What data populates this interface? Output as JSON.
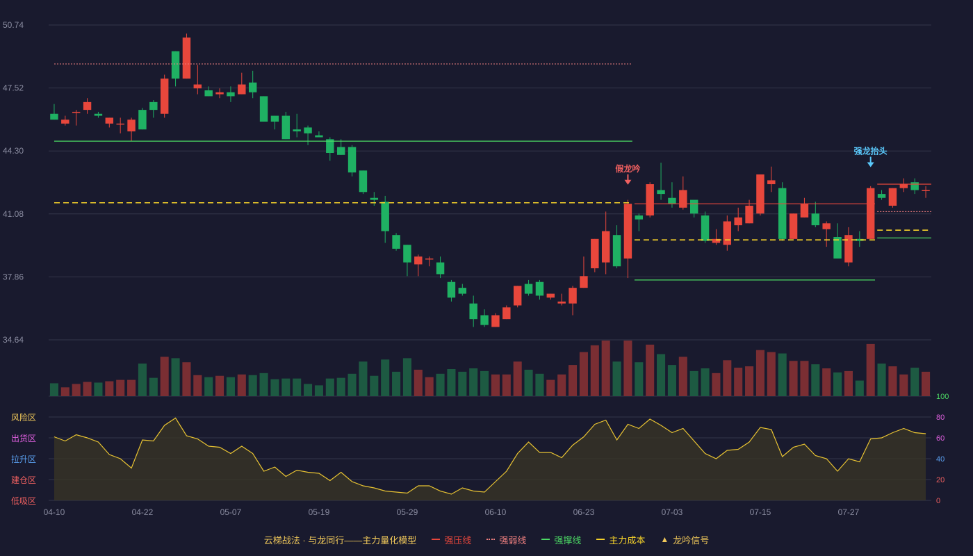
{
  "colors": {
    "up": "#e8473c",
    "down": "#1fb163",
    "up_vol": "#7a2e33",
    "down_vol": "#1d5a42",
    "grid": "#34364a",
    "axis_text": "#8a8ca0",
    "pressure": "#e8473c",
    "weak": "#f08080",
    "support": "#4cd964",
    "cost": "#f5d12a",
    "osc_line": "#e8c332"
  },
  "legend": {
    "title": "云梯战法 · 与龙同行——主力量化模型",
    "items": [
      {
        "label": "强压线",
        "color": "#e8473c",
        "style": "solid"
      },
      {
        "label": "强弱线",
        "color": "#f08080",
        "style": "dotted"
      },
      {
        "label": "强撑线",
        "color": "#4cd964",
        "style": "solid"
      },
      {
        "label": "主力成本",
        "color": "#f5d12a",
        "style": "dashed"
      },
      {
        "label": "龙吟信号",
        "color": "#f0c85a",
        "style": "triangle"
      }
    ]
  },
  "chart_data": {
    "type": "candlestick",
    "price_axis": {
      "ticks": [
        "50.74",
        "47.52",
        "44.30",
        "41.08",
        "37.86",
        "34.64"
      ],
      "ylim": [
        34.64,
        50.74
      ]
    },
    "x_ticks": [
      {
        "index": 0,
        "label": "04-10"
      },
      {
        "index": 8,
        "label": "04-22"
      },
      {
        "index": 16,
        "label": "05-07"
      },
      {
        "index": 24,
        "label": "05-19"
      },
      {
        "index": 32,
        "label": "05-29"
      },
      {
        "index": 40,
        "label": "06-10"
      },
      {
        "index": 48,
        "label": "06-23"
      },
      {
        "index": 56,
        "label": "07-03"
      },
      {
        "index": 64,
        "label": "07-15"
      },
      {
        "index": 72,
        "label": "07-27"
      }
    ],
    "candles": [
      [
        46.2,
        45.9,
        46.7,
        45.9
      ],
      [
        45.7,
        45.9,
        46.1,
        45.6
      ],
      [
        46.3,
        46.3,
        46.4,
        45.6
      ],
      [
        46.4,
        46.8,
        47.0,
        46.2
      ],
      [
        46.2,
        46.1,
        46.3,
        46.0
      ],
      [
        45.7,
        46.0,
        46.0,
        45.5
      ],
      [
        45.7,
        45.7,
        46.0,
        45.2
      ],
      [
        45.3,
        45.9,
        46.0,
        44.8
      ],
      [
        46.4,
        45.4,
        46.5,
        45.4
      ],
      [
        46.8,
        46.4,
        46.9,
        46.0
      ],
      [
        46.2,
        48.0,
        48.2,
        46.0
      ],
      [
        49.4,
        48.0,
        49.4,
        47.6
      ],
      [
        48.0,
        50.1,
        50.3,
        48.0
      ],
      [
        47.5,
        47.7,
        48.7,
        47.2
      ],
      [
        47.4,
        47.1,
        47.6,
        47.1
      ],
      [
        47.2,
        47.3,
        47.5,
        47.0
      ],
      [
        47.3,
        47.1,
        47.6,
        46.8
      ],
      [
        47.2,
        47.7,
        48.3,
        47.2
      ],
      [
        47.8,
        47.3,
        48.4,
        47.0
      ],
      [
        47.1,
        45.8,
        47.1,
        45.8
      ],
      [
        46.1,
        45.8,
        46.1,
        45.4
      ],
      [
        46.1,
        44.9,
        46.3,
        44.9
      ],
      [
        45.4,
        45.3,
        46.2,
        45.0
      ],
      [
        45.5,
        45.2,
        45.6,
        44.6
      ],
      [
        45.1,
        45.0,
        45.3,
        45.0
      ],
      [
        44.9,
        44.2,
        45.0,
        43.8
      ],
      [
        44.5,
        44.1,
        44.9,
        44.1
      ],
      [
        44.5,
        43.2,
        44.6,
        43.0
      ],
      [
        43.3,
        42.2,
        43.3,
        42.1
      ],
      [
        41.9,
        41.8,
        42.2,
        41.5
      ],
      [
        41.7,
        40.2,
        42.0,
        39.6
      ],
      [
        40.0,
        39.3,
        40.1,
        39.2
      ],
      [
        39.5,
        38.6,
        39.5,
        37.9
      ],
      [
        38.5,
        38.9,
        39.0,
        37.9
      ],
      [
        38.8,
        38.8,
        38.9,
        38.4
      ],
      [
        38.6,
        38.0,
        38.9,
        37.8
      ],
      [
        37.6,
        36.8,
        37.7,
        36.6
      ],
      [
        37.3,
        37.0,
        37.5,
        36.9
      ],
      [
        36.5,
        35.7,
        36.9,
        35.3
      ],
      [
        35.9,
        35.4,
        36.2,
        35.3
      ],
      [
        35.3,
        35.9,
        36.0,
        35.3
      ],
      [
        35.7,
        36.3,
        36.4,
        35.7
      ],
      [
        36.4,
        37.4,
        37.4,
        36.3
      ],
      [
        37.5,
        37.0,
        37.7,
        36.9
      ],
      [
        37.6,
        36.9,
        37.7,
        36.7
      ],
      [
        36.8,
        37.0,
        37.0,
        36.7
      ],
      [
        36.5,
        36.6,
        37.0,
        36.4
      ],
      [
        36.5,
        37.3,
        37.4,
        35.9
      ],
      [
        37.3,
        37.9,
        38.9,
        37.3
      ],
      [
        38.3,
        39.8,
        39.8,
        38.1
      ],
      [
        38.6,
        40.2,
        41.2,
        38.0
      ],
      [
        40.0,
        38.4,
        40.5,
        38.3
      ],
      [
        38.8,
        41.6,
        41.8,
        37.8
      ],
      [
        41.0,
        40.8,
        41.1,
        40.2
      ],
      [
        41.0,
        42.6,
        42.7,
        40.9
      ],
      [
        42.3,
        42.1,
        43.7,
        41.8
      ],
      [
        41.9,
        41.6,
        42.7,
        41.4
      ],
      [
        41.4,
        42.3,
        43.0,
        41.3
      ],
      [
        41.8,
        41.1,
        41.8,
        40.9
      ],
      [
        41.0,
        39.7,
        41.2,
        39.6
      ],
      [
        39.6,
        39.8,
        40.3,
        39.5
      ],
      [
        39.5,
        40.7,
        41.0,
        39.2
      ],
      [
        40.5,
        40.9,
        41.4,
        40.2
      ],
      [
        40.6,
        41.5,
        41.8,
        40.6
      ],
      [
        41.1,
        43.1,
        43.1,
        41.0
      ],
      [
        42.6,
        42.8,
        43.5,
        42.2
      ],
      [
        42.4,
        39.8,
        42.7,
        39.7
      ],
      [
        39.8,
        41.1,
        41.1,
        39.8
      ],
      [
        40.9,
        41.6,
        41.9,
        40.9
      ],
      [
        41.1,
        40.5,
        41.7,
        40.4
      ],
      [
        40.3,
        40.6,
        40.7,
        39.4
      ],
      [
        39.9,
        38.8,
        40.6,
        38.8
      ],
      [
        38.6,
        40.0,
        40.4,
        38.4
      ],
      [
        39.8,
        39.7,
        40.2,
        39.4
      ],
      [
        39.8,
        42.4,
        42.5,
        39.8
      ],
      [
        42.1,
        41.9,
        42.3,
        41.8
      ],
      [
        41.5,
        42.4,
        42.4,
        41.4
      ],
      [
        42.4,
        42.6,
        42.9,
        42.2
      ],
      [
        42.7,
        42.3,
        42.9,
        42.1
      ],
      [
        42.3,
        42.3,
        42.5,
        41.9
      ]
    ],
    "volume": [
      19,
      13,
      18,
      21,
      20,
      22,
      24,
      24,
      48,
      27,
      58,
      56,
      50,
      31,
      28,
      30,
      28,
      32,
      31,
      34,
      25,
      26,
      26,
      18,
      16,
      26,
      27,
      33,
      51,
      30,
      54,
      36,
      56,
      39,
      28,
      33,
      40,
      36,
      41,
      37,
      32,
      32,
      51,
      39,
      33,
      24,
      32,
      46,
      65,
      75,
      82,
      51,
      82,
      50,
      76,
      62,
      46,
      58,
      37,
      41,
      34,
      53,
      42,
      44,
      68,
      65,
      63,
      52,
      52,
      47,
      41,
      35,
      37,
      23,
      77,
      48,
      44,
      32,
      42,
      36
    ],
    "oscillator": {
      "ticks": [
        0,
        20,
        40,
        60,
        80,
        100
      ],
      "zones": [
        "风险区",
        "出货区",
        "拉升区",
        "建仓区",
        "低吸区"
      ],
      "zone_colors": [
        "#f0c85a",
        "#e060e0",
        "#5aa0f0",
        "#f06060",
        "#f06060"
      ],
      "values": [
        61,
        57,
        63,
        60,
        56,
        44,
        40,
        31,
        58,
        57,
        72,
        79,
        62,
        59,
        52,
        51,
        45,
        52,
        45,
        28,
        32,
        23,
        29,
        27,
        26,
        19,
        27,
        18,
        14,
        12,
        9,
        8,
        7,
        14,
        14,
        9,
        6,
        12,
        9,
        8,
        18,
        28,
        45,
        56,
        46,
        46,
        41,
        53,
        61,
        73,
        77,
        58,
        73,
        69,
        78,
        72,
        65,
        69,
        57,
        45,
        40,
        48,
        49,
        56,
        70,
        68,
        42,
        51,
        54,
        43,
        40,
        28,
        40,
        37,
        59,
        60,
        65,
        69,
        65,
        64
      ]
    },
    "lines": {
      "weak_1": {
        "price": 48.75,
        "start": 0,
        "end": 52
      },
      "support_1": {
        "price": 44.8,
        "start": 0,
        "end": 52
      },
      "cost_1": {
        "price": 41.65,
        "start": 0,
        "end": 52
      },
      "pressure_2": {
        "price": 41.6,
        "start": 53,
        "end": 74
      },
      "cost_2": {
        "price": 39.75,
        "start": 53,
        "end": 74
      },
      "support_2": {
        "price": 37.7,
        "start": 53,
        "end": 74
      },
      "pressure_3": {
        "price": 42.6,
        "start": 75,
        "end": 80
      },
      "weak_3": {
        "price": 41.2,
        "start": 75,
        "end": 80
      },
      "cost_3": {
        "price": 40.25,
        "start": 75,
        "end": 80
      },
      "support_3": {
        "price": 39.85,
        "start": 75,
        "end": 80
      }
    },
    "signals": [
      {
        "index": 52,
        "label": "假龙吟",
        "price": 42.75,
        "color": "#f06060"
      },
      {
        "index": 74,
        "label": "强龙抬头",
        "price": 43.65,
        "color": "#5ac8fa"
      }
    ]
  }
}
